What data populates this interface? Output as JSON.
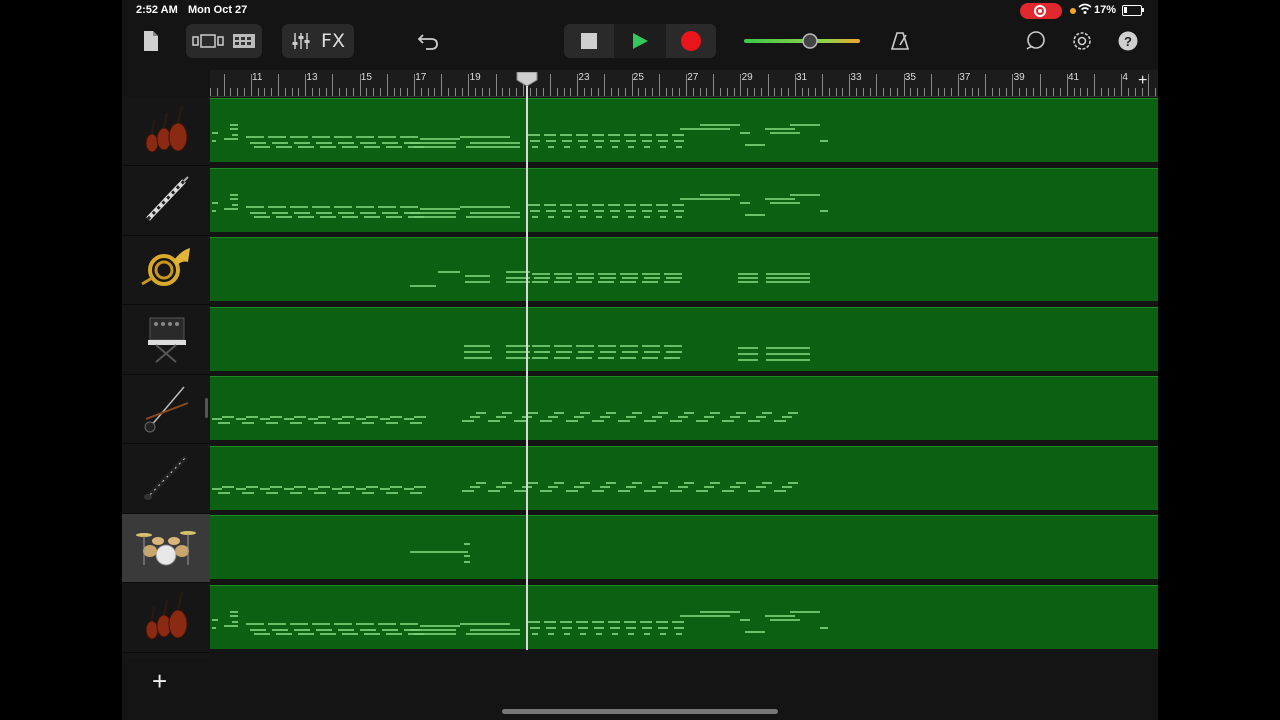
{
  "status_bar": {
    "time": "2:52 AM",
    "date": "Mon Oct 27",
    "battery_text": "17%",
    "recording_color": "#e0282e"
  },
  "toolbar": {
    "fx_label": "FX",
    "icons": [
      "document-icon",
      "view-toggle-icon",
      "tracks-view-icon",
      "mixer-icon",
      "undo-icon",
      "stop-icon",
      "play-icon",
      "record-icon",
      "master-volume-slider",
      "metronome-icon",
      "loop-icon",
      "settings-icon",
      "help-icon"
    ],
    "play_color": "#34c759",
    "record_color": "#e8151b",
    "master_volume": 0.52
  },
  "ruler": {
    "bars": [
      "11",
      "13",
      "15",
      "17",
      "19",
      "21",
      "23",
      "25",
      "27",
      "29",
      "31",
      "33",
      "35",
      "37",
      "39",
      "41",
      "4"
    ],
    "playhead_bar": "21",
    "add_label": "+"
  },
  "tracks": [
    {
      "name": "strings",
      "icon": "strings-icon",
      "pattern": "strings"
    },
    {
      "name": "bassoon",
      "icon": "bassoon-icon",
      "pattern": "strings"
    },
    {
      "name": "french-horn",
      "icon": "french-horn-icon",
      "pattern": "horn"
    },
    {
      "name": "synth",
      "icon": "synth-keyboard-icon",
      "pattern": "synth"
    },
    {
      "name": "erhu",
      "icon": "erhu-icon",
      "pattern": "erhu"
    },
    {
      "name": "oboe",
      "icon": "oboe-icon",
      "pattern": "erhu"
    },
    {
      "name": "drums",
      "icon": "drum-kit-icon",
      "pattern": "drums",
      "selected": true
    },
    {
      "name": "strings-2",
      "icon": "strings-icon",
      "pattern": "strings"
    }
  ],
  "colors": {
    "region": "#0b6111",
    "note": "#9ff59a"
  },
  "add_track_label": "+"
}
